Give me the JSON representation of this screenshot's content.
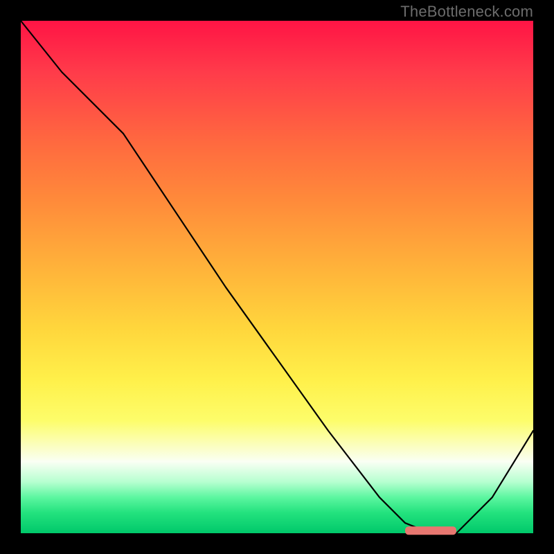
{
  "watermark": "TheBottleneck.com",
  "colors": {
    "frame": "#000000",
    "curve": "#000000",
    "marker": "#e77770",
    "gradient_stops": [
      "#ff1445",
      "#ff3b4a",
      "#ff6a3f",
      "#ff8a3a",
      "#ffb23a",
      "#ffd63c",
      "#fff04a",
      "#fdfd6a",
      "#fafff4",
      "#b6ffd0",
      "#5cf6a0",
      "#23e27e",
      "#00c86a"
    ]
  },
  "chart_data": {
    "type": "line",
    "title": "",
    "xlabel": "",
    "ylabel": "",
    "xlim": [
      0,
      100
    ],
    "ylim": [
      0,
      100
    ],
    "grid": false,
    "legend": null,
    "series": [
      {
        "name": "curve",
        "x": [
          0,
          8,
          20,
          30,
          40,
          50,
          60,
          70,
          75,
          80,
          85,
          92,
          100
        ],
        "y": [
          100,
          90,
          78,
          63,
          48,
          34,
          20,
          7,
          2,
          0,
          0,
          7,
          20
        ]
      }
    ],
    "marker_segment": {
      "x0": 75,
      "x1": 85,
      "y": 0.5
    }
  }
}
